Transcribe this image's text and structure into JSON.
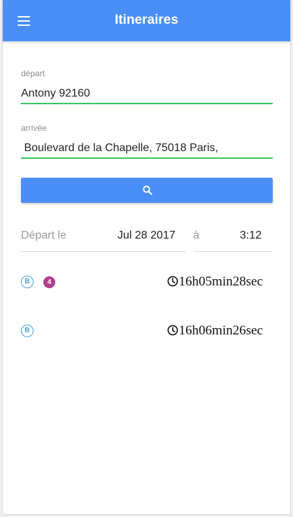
{
  "header": {
    "title": "Itineraires",
    "menu_icon": "hamburger-menu-icon"
  },
  "form": {
    "depart_label": "départ",
    "depart_value": "Antony 92160",
    "arrivee_label": "arrivée",
    "arrivee_value": " Boulevard de la Chapelle, 75018 Paris,",
    "search_icon": "search-icon",
    "accent_color": "#4a8ff7",
    "field_underline_color": "#35c85a"
  },
  "date": {
    "label": "Départ le",
    "value": "Jul 28 2017",
    "a_label": "à",
    "time": "3:12"
  },
  "results": [
    {
      "line_badge": "B",
      "extra_badge": "4",
      "duration": "16h05min28sec",
      "badge_colors": {
        "line": "#4a9fd8",
        "extra": "#b0408f"
      }
    },
    {
      "line_badge": "B",
      "duration": "16h06min26sec",
      "badge_colors": {
        "line": "#4a9fd8"
      }
    }
  ]
}
